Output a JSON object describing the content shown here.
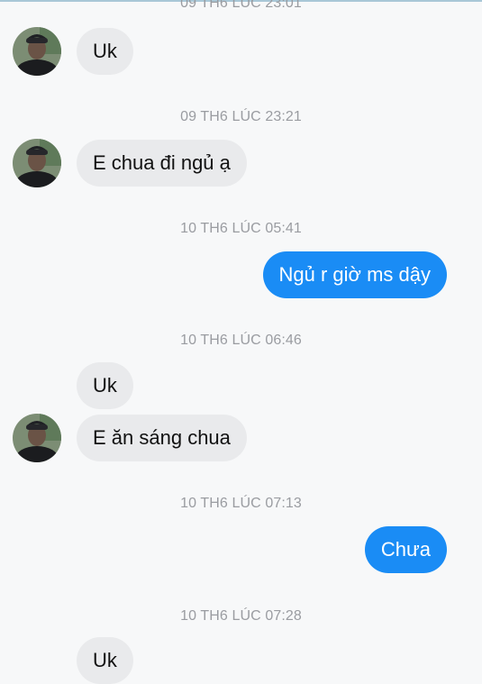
{
  "colors": {
    "incoming_bubble": "#e9eaec",
    "outgoing_bubble": "#1a8cf5",
    "timestamp": "#9a9ca1",
    "background": "#f7f8f9"
  },
  "avatar_icon": "contact-avatar-photo",
  "timestamps": [
    "09 TH6 LÚC 23:01",
    "09 TH6 LÚC 23:21",
    "10 TH6 LÚC 05:41",
    "10 TH6 LÚC 06:46",
    "10 TH6 LÚC 07:13",
    "10 TH6 LÚC 07:28"
  ],
  "messages": [
    {
      "direction": "incoming",
      "text": "Uk"
    },
    {
      "direction": "incoming",
      "text": "E chua đi ngủ ạ"
    },
    {
      "direction": "outgoing",
      "text": "Ngủ r giờ ms dậy"
    },
    {
      "direction": "incoming",
      "text": "Uk"
    },
    {
      "direction": "incoming",
      "text": "E ăn sáng chua"
    },
    {
      "direction": "outgoing",
      "text": "Chưa"
    },
    {
      "direction": "incoming",
      "text": "Uk"
    }
  ]
}
